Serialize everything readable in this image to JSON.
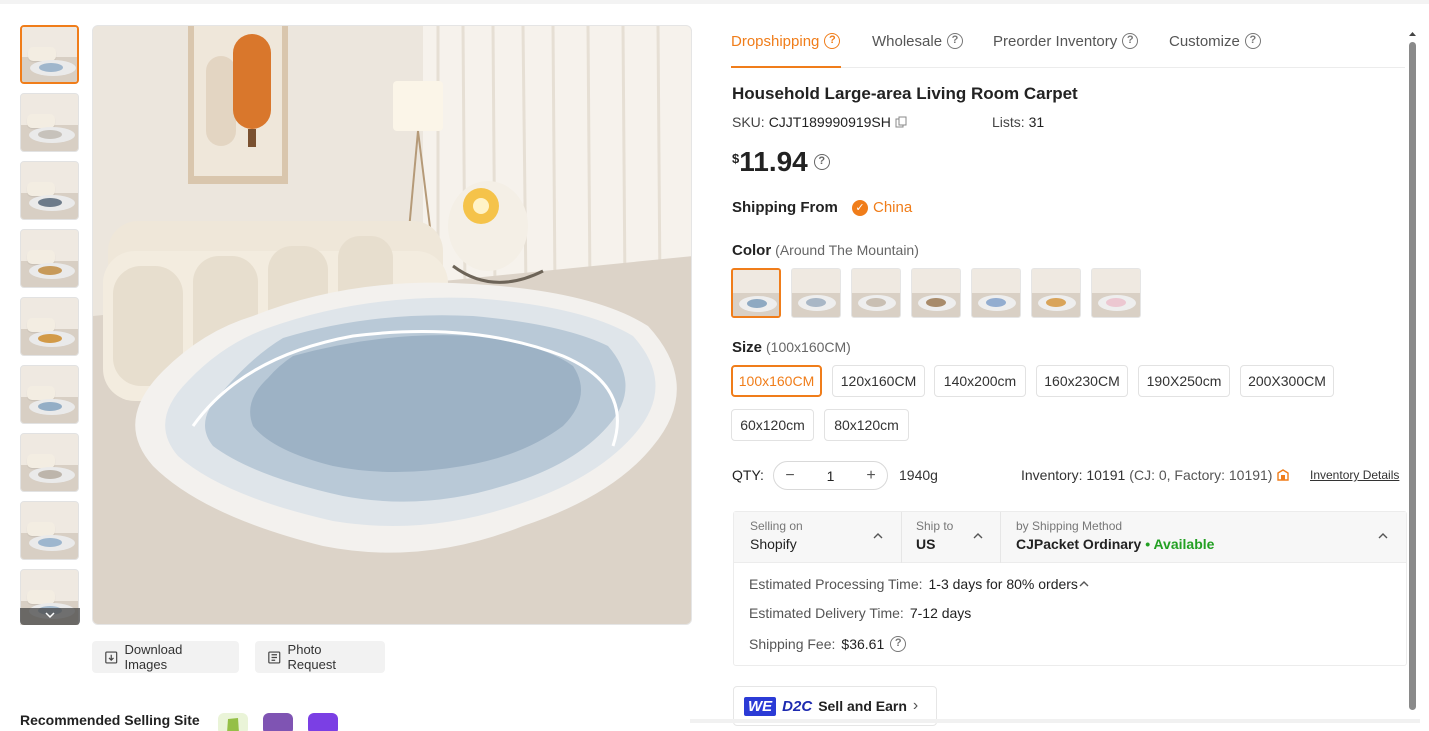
{
  "thumbnails": [
    {
      "rug": "#9fb6cc"
    },
    {
      "rug": "#c7c2bb"
    },
    {
      "rug": "#6d7b8a"
    },
    {
      "rug": "#c79a5a"
    },
    {
      "rug": "#d29a48"
    },
    {
      "rug": "#94aec6"
    },
    {
      "rug": "#bdb5ab"
    },
    {
      "rug": "#9db6ce"
    },
    {
      "rug": "#a7bccf"
    }
  ],
  "image_actions": {
    "download": "Download Images",
    "photo_request": "Photo Request"
  },
  "recommended": {
    "label": "Recommended Selling Site",
    "sites": [
      {
        "name": "shopify-icon",
        "color": "#95bf47"
      },
      {
        "name": "woocommerce-icon",
        "color": "#7f54b3"
      },
      {
        "name": "wix-icon",
        "color": "#7b3fe4"
      }
    ]
  },
  "tabs": [
    {
      "label": "Dropshipping",
      "active": true
    },
    {
      "label": "Wholesale",
      "active": false
    },
    {
      "label": "Preorder Inventory",
      "active": false
    },
    {
      "label": "Customize",
      "active": false
    }
  ],
  "product": {
    "title": "Household Large-area Living Room Carpet",
    "sku_label": "SKU:",
    "sku": "CJJT189990919SH",
    "lists_label": "Lists:",
    "lists": "31",
    "currency": "$",
    "price": "11.94"
  },
  "shipping_from": {
    "label": "Shipping From",
    "value": "China"
  },
  "color": {
    "label": "Color",
    "selected": "(Around The Mountain)",
    "swatches": [
      {
        "rug": "#8ea9c2",
        "active": true
      },
      {
        "rug": "#a9b7c6",
        "active": false
      },
      {
        "rug": "#c9bfb3",
        "active": false
      },
      {
        "rug": "#a88b6b",
        "active": false
      },
      {
        "rug": "#93add0",
        "active": false
      },
      {
        "rug": "#d9a45a",
        "active": false
      },
      {
        "rug": "#ecc7d1",
        "active": false
      }
    ]
  },
  "size": {
    "label": "Size",
    "selected": "(100x160CM)",
    "options": [
      "100x160CM",
      "120x160CM",
      "140x200cm",
      "160x230CM",
      "190X250cm",
      "200X300CM",
      "60x120cm",
      "80x120cm"
    ],
    "active_index": 0
  },
  "qty": {
    "label": "QTY:",
    "value": "1",
    "minus": "−",
    "plus": "+",
    "weight": "1940g"
  },
  "inventory": {
    "text": "Inventory: 10191",
    "detail": "(CJ: 0, Factory: 10191)",
    "link": "Inventory Details"
  },
  "shipping": {
    "selling_on_label": "Selling on",
    "selling_on": "Shopify",
    "ship_to_label": "Ship to",
    "ship_to": "US",
    "method_label": "by Shipping Method",
    "method": "CJPacket Ordinary",
    "status": "• Available",
    "processing_label": "Estimated Processing Time:",
    "processing": "1-3 days for 80% orders",
    "delivery_label": "Estimated Delivery Time:",
    "delivery": "7-12 days",
    "fee_label": "Shipping Fee:",
    "fee": "$36.61"
  },
  "d2c": {
    "we": "WE",
    "d2c": "D2C",
    "label": "Sell and Earn",
    "arrow": "›"
  },
  "colors": {
    "accent": "#f07d1a",
    "available": "#23a023",
    "d2c_blue": "#2b3bd6"
  }
}
